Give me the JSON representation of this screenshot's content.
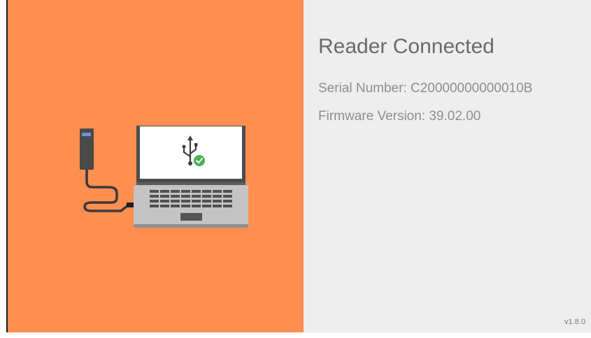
{
  "status": {
    "title": "Reader Connected",
    "serial_number": "Serial Number: C20000000000010B",
    "firmware_version": "Firmware Version: 39.02.00"
  },
  "footer": {
    "version": "v1.8.0"
  },
  "illustration": {
    "reader_icon": "card-reader-icon",
    "laptop_icon": "laptop-icon",
    "usb_icon": "usb-icon",
    "check_icon": "check-badge-icon"
  },
  "colors": {
    "left_panel_bg": "#ff8f50",
    "right_panel_bg": "#eeeeee",
    "check_green": "#4caf50",
    "title_text": "#6a6a6a",
    "info_text": "#8e8e8e"
  }
}
